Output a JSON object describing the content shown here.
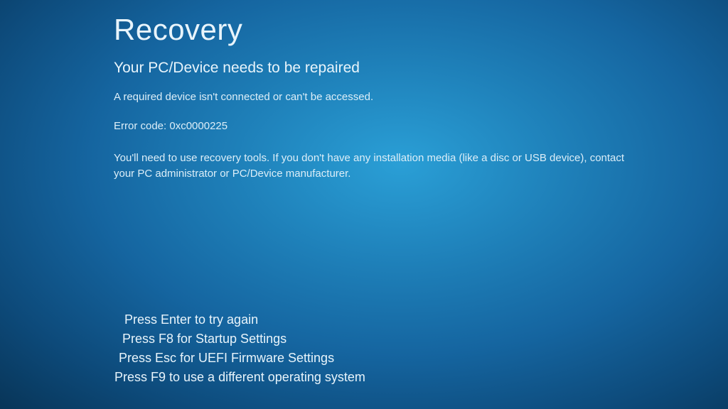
{
  "title": "Recovery",
  "subtitle": "Your PC/Device needs to be repaired",
  "message": "A required device isn't connected or can't be accessed.",
  "error_label": "Error code:",
  "error_code": "0xc0000225",
  "instructions": "You'll need to use recovery tools. If you don't have any installation media (like a disc or USB device), contact your PC administrator or PC/Device manufacturer.",
  "actions": [
    "Press Enter to try again",
    "Press F8 for Startup Settings",
    "Press Esc for UEFI Firmware Settings",
    "Press F9 to use a different operating system"
  ]
}
